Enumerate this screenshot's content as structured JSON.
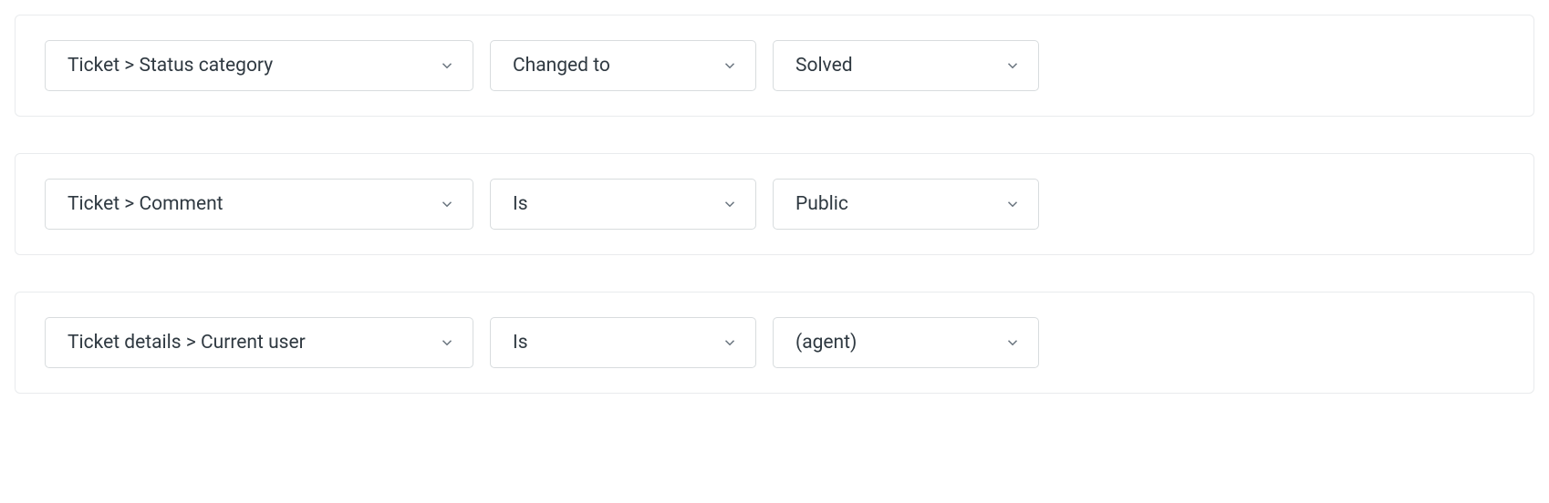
{
  "conditions": [
    {
      "field": "Ticket > Status category",
      "operator": "Changed to",
      "value": "Solved"
    },
    {
      "field": "Ticket > Comment",
      "operator": "Is",
      "value": "Public"
    },
    {
      "field": "Ticket details > Current user",
      "operator": "Is",
      "value": "(agent)"
    }
  ]
}
